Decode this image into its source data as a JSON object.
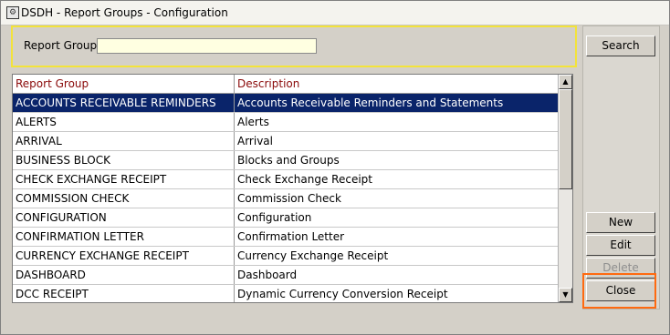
{
  "window": {
    "title": "DSDH - Report Groups - Configuration"
  },
  "filter": {
    "label": "Report Group",
    "value": ""
  },
  "grid": {
    "columns": [
      "Report Group",
      "Description"
    ],
    "rows": [
      [
        "ACCOUNTS RECEIVABLE REMINDERS",
        "Accounts Receivable Reminders and Statements"
      ],
      [
        "ALERTS",
        "Alerts"
      ],
      [
        "ARRIVAL",
        "Arrival"
      ],
      [
        "BUSINESS BLOCK",
        "Blocks and Groups"
      ],
      [
        "CHECK EXCHANGE RECEIPT",
        "Check Exchange Receipt"
      ],
      [
        "COMMISSION CHECK",
        "Commission Check"
      ],
      [
        "CONFIGURATION",
        "Configuration"
      ],
      [
        "CONFIRMATION LETTER",
        "Confirmation Letter"
      ],
      [
        "CURRENCY EXCHANGE RECEIPT",
        "Currency Exchange Receipt"
      ],
      [
        "DASHBOARD",
        "Dashboard"
      ],
      [
        "DCC RECEIPT",
        "Dynamic Currency Conversion Receipt"
      ]
    ],
    "selected_row": 0
  },
  "buttons": {
    "search": "Search",
    "new": "New",
    "edit": "Edit",
    "delete": "Delete",
    "close": "Close"
  },
  "colors": {
    "selection": "#0a246a",
    "header_text": "#8a0a0a",
    "filter_border": "#f3e33a",
    "highlight": "#ff6a10"
  }
}
